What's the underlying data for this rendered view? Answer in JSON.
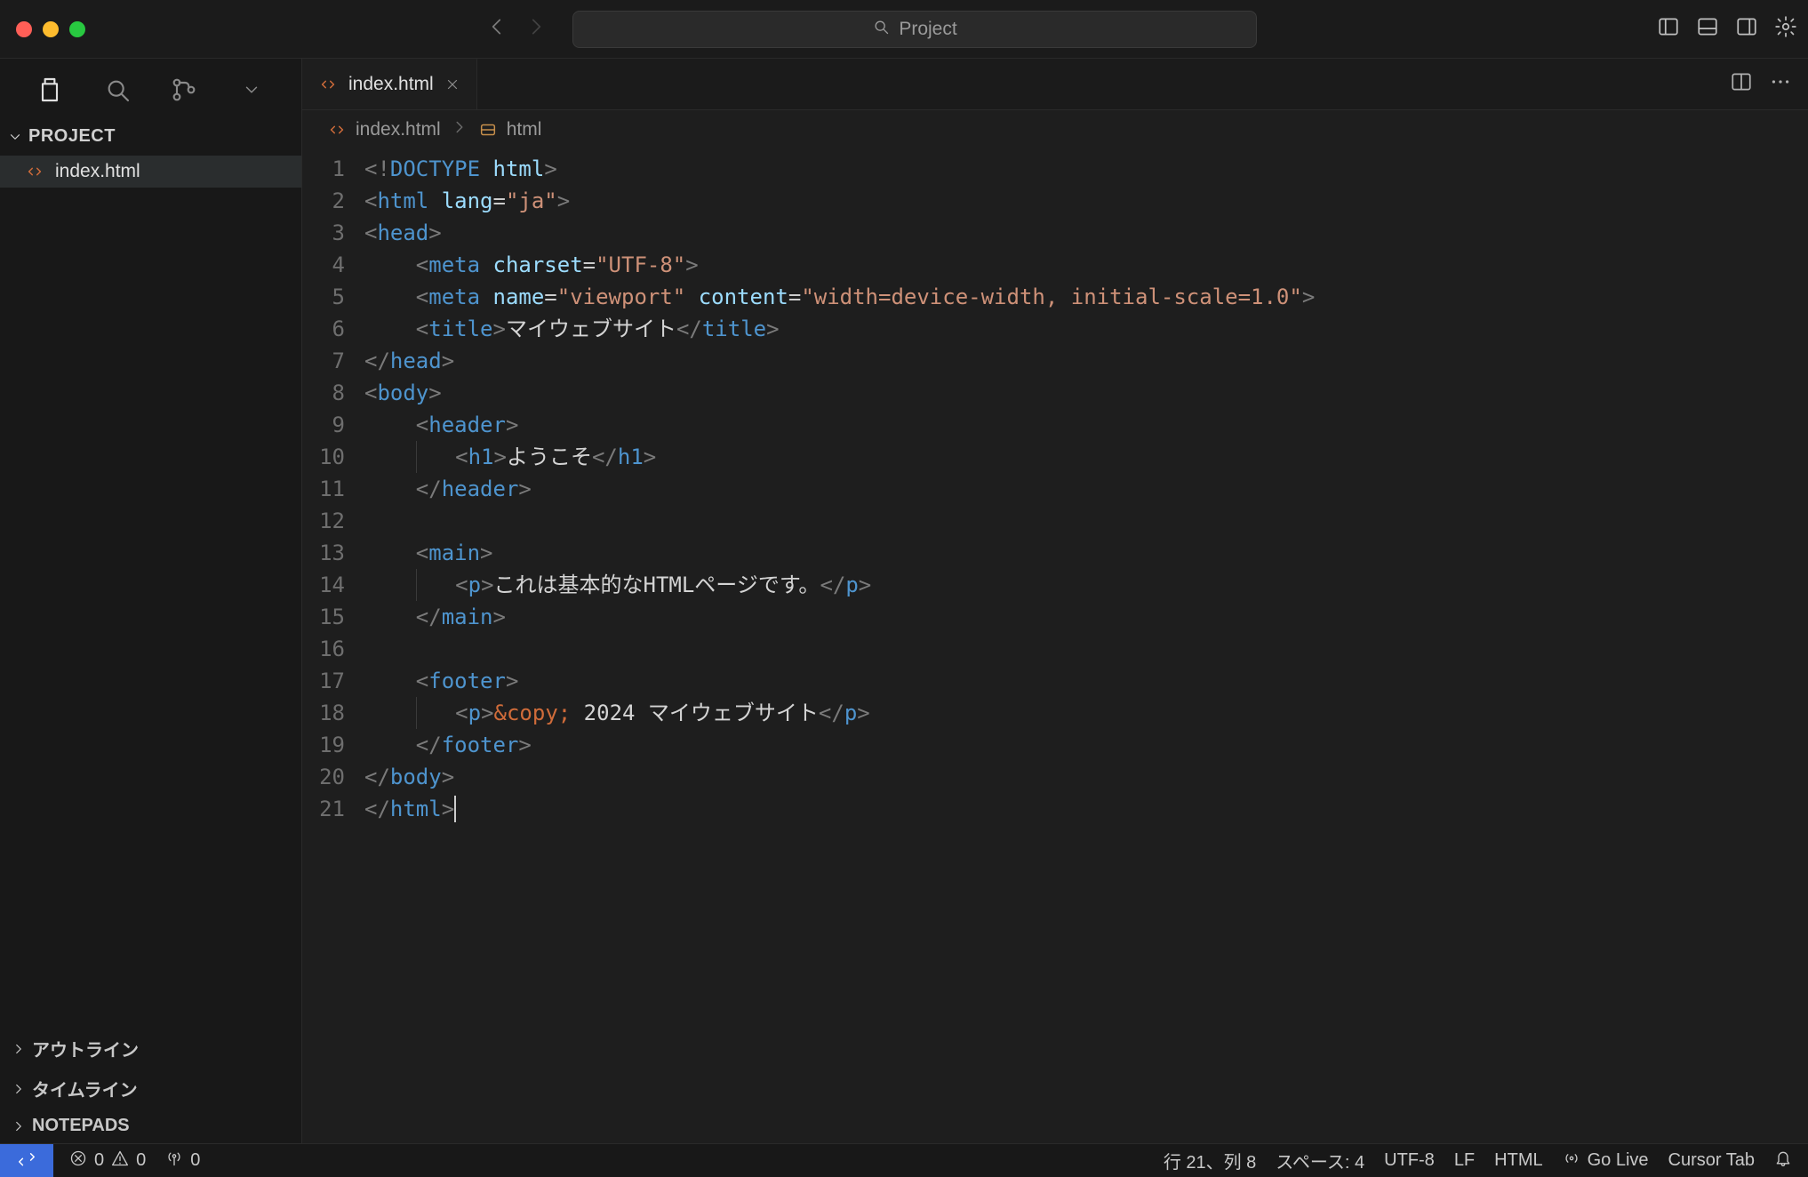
{
  "titlebar": {
    "project_label": "Project"
  },
  "sidebar": {
    "title": "PROJECT",
    "files": [
      {
        "name": "index.html"
      }
    ],
    "panels": [
      {
        "label": "アウトライン"
      },
      {
        "label": "タイムライン"
      },
      {
        "label": "NOTEPADS"
      }
    ]
  },
  "tabs": {
    "items": [
      {
        "label": "index.html"
      }
    ]
  },
  "breadcrumb": {
    "file": "index.html",
    "symbol": "html"
  },
  "editor": {
    "line_count": 21,
    "lines": [
      {
        "n": 1,
        "indent": 0,
        "tokens": [
          [
            "br",
            "<"
          ],
          [
            "br",
            "!"
          ],
          [
            "doctype",
            "DOCTYPE"
          ],
          [
            "text",
            " "
          ],
          [
            "attr",
            "html"
          ],
          [
            "br",
            ">"
          ]
        ]
      },
      {
        "n": 2,
        "indent": 0,
        "tokens": [
          [
            "br",
            "<"
          ],
          [
            "tag",
            "html"
          ],
          [
            "text",
            " "
          ],
          [
            "attr",
            "lang"
          ],
          [
            "eq",
            "="
          ],
          [
            "str",
            "\"ja\""
          ],
          [
            "br",
            ">"
          ]
        ]
      },
      {
        "n": 3,
        "indent": 0,
        "tokens": [
          [
            "br",
            "<"
          ],
          [
            "tag",
            "head"
          ],
          [
            "br",
            ">"
          ]
        ]
      },
      {
        "n": 4,
        "indent": 1,
        "tokens": [
          [
            "br",
            "<"
          ],
          [
            "tag",
            "meta"
          ],
          [
            "text",
            " "
          ],
          [
            "attr",
            "charset"
          ],
          [
            "eq",
            "="
          ],
          [
            "str",
            "\"UTF-8\""
          ],
          [
            "br",
            ">"
          ]
        ]
      },
      {
        "n": 5,
        "indent": 1,
        "tokens": [
          [
            "br",
            "<"
          ],
          [
            "tag",
            "meta"
          ],
          [
            "text",
            " "
          ],
          [
            "attr",
            "name"
          ],
          [
            "eq",
            "="
          ],
          [
            "str",
            "\"viewport\""
          ],
          [
            "text",
            " "
          ],
          [
            "attr",
            "content"
          ],
          [
            "eq",
            "="
          ],
          [
            "str",
            "\"width=device-width, initial-scale=1.0\""
          ],
          [
            "br",
            ">"
          ]
        ]
      },
      {
        "n": 6,
        "indent": 1,
        "tokens": [
          [
            "br",
            "<"
          ],
          [
            "tag",
            "title"
          ],
          [
            "br",
            ">"
          ],
          [
            "text",
            "マイウェブサイト"
          ],
          [
            "br",
            "</"
          ],
          [
            "tag",
            "title"
          ],
          [
            "br",
            ">"
          ]
        ]
      },
      {
        "n": 7,
        "indent": 0,
        "tokens": [
          [
            "br",
            "</"
          ],
          [
            "tag",
            "head"
          ],
          [
            "br",
            ">"
          ]
        ]
      },
      {
        "n": 8,
        "indent": 0,
        "tokens": [
          [
            "br",
            "<"
          ],
          [
            "tag",
            "body"
          ],
          [
            "br",
            ">"
          ]
        ]
      },
      {
        "n": 9,
        "indent": 1,
        "tokens": [
          [
            "br",
            "<"
          ],
          [
            "tag",
            "header"
          ],
          [
            "br",
            ">"
          ]
        ]
      },
      {
        "n": 10,
        "indent": 2,
        "guide": true,
        "tokens": [
          [
            "br",
            "<"
          ],
          [
            "tag",
            "h1"
          ],
          [
            "br",
            ">"
          ],
          [
            "text",
            "ようこそ"
          ],
          [
            "br",
            "</"
          ],
          [
            "tag",
            "h1"
          ],
          [
            "br",
            ">"
          ]
        ]
      },
      {
        "n": 11,
        "indent": 1,
        "tokens": [
          [
            "br",
            "</"
          ],
          [
            "tag",
            "header"
          ],
          [
            "br",
            ">"
          ]
        ]
      },
      {
        "n": 12,
        "indent": 0,
        "tokens": []
      },
      {
        "n": 13,
        "indent": 1,
        "tokens": [
          [
            "br",
            "<"
          ],
          [
            "tag",
            "main"
          ],
          [
            "br",
            ">"
          ]
        ]
      },
      {
        "n": 14,
        "indent": 2,
        "guide": true,
        "tokens": [
          [
            "br",
            "<"
          ],
          [
            "tag",
            "p"
          ],
          [
            "br",
            ">"
          ],
          [
            "text",
            "これは基本的なHTMLページです。"
          ],
          [
            "br",
            "</"
          ],
          [
            "tag",
            "p"
          ],
          [
            "br",
            ">"
          ]
        ]
      },
      {
        "n": 15,
        "indent": 1,
        "tokens": [
          [
            "br",
            "</"
          ],
          [
            "tag",
            "main"
          ],
          [
            "br",
            ">"
          ]
        ]
      },
      {
        "n": 16,
        "indent": 0,
        "tokens": []
      },
      {
        "n": 17,
        "indent": 1,
        "tokens": [
          [
            "br",
            "<"
          ],
          [
            "tag",
            "footer"
          ],
          [
            "br",
            ">"
          ]
        ]
      },
      {
        "n": 18,
        "indent": 2,
        "guide": true,
        "tokens": [
          [
            "br",
            "<"
          ],
          [
            "tag",
            "p"
          ],
          [
            "br",
            ">"
          ],
          [
            "ent",
            "&copy;"
          ],
          [
            "text",
            " 2024 マイウェブサイト"
          ],
          [
            "br",
            "</"
          ],
          [
            "tag",
            "p"
          ],
          [
            "br",
            ">"
          ]
        ]
      },
      {
        "n": 19,
        "indent": 1,
        "tokens": [
          [
            "br",
            "</"
          ],
          [
            "tag",
            "footer"
          ],
          [
            "br",
            ">"
          ]
        ]
      },
      {
        "n": 20,
        "indent": 0,
        "tokens": [
          [
            "br",
            "</"
          ],
          [
            "tag",
            "body"
          ],
          [
            "br",
            ">"
          ]
        ]
      },
      {
        "n": 21,
        "indent": 0,
        "cursor": true,
        "tokens": [
          [
            "br",
            "</"
          ],
          [
            "tag",
            "html"
          ],
          [
            "br",
            ">"
          ]
        ]
      }
    ]
  },
  "status": {
    "errors": "0",
    "warnings": "0",
    "ports": "0",
    "cursor": "行 21、列 8",
    "spaces": "スペース: 4",
    "encoding": "UTF-8",
    "eol": "LF",
    "language": "HTML",
    "golive": "Go Live",
    "cursortab": "Cursor Tab"
  }
}
